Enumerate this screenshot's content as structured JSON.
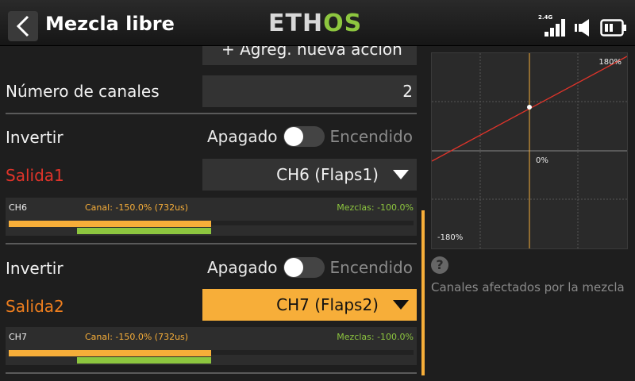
{
  "header": {
    "title": "Mezcla libre",
    "logo_eth": "ETH",
    "logo_os": "OS",
    "signal_label": "2.4G"
  },
  "main": {
    "add_action_label": "+ Agreg. nueva acción",
    "num_channels": {
      "label": "Número de canales",
      "value": "2"
    },
    "outputs": [
      {
        "invert_label": "Invertir",
        "off_label": "Apagado",
        "on_label": "Encendido",
        "output_label": "Salida1",
        "output_label_color": "#e0342a",
        "channel_value": "CH6 (Flaps1)",
        "bar": {
          "channel": "CH6",
          "canal_text": "Canal: -150.0% (732us)",
          "mezclas_text": "Mezclas: -100.0%",
          "canal_percent": -150.0,
          "mezclas_percent": -100.0
        }
      },
      {
        "invert_label": "Invertir",
        "off_label": "Apagado",
        "on_label": "Encendido",
        "output_label": "Salida2",
        "output_label_color": "#f07f1e",
        "channel_value": "CH7 (Flaps2)",
        "bar": {
          "channel": "CH7",
          "canal_text": "Canal: -150.0% (732us)",
          "mezclas_text": "Mezclas: -100.0%",
          "canal_percent": -150.0,
          "mezclas_percent": -100.0
        }
      }
    ]
  },
  "graph": {
    "top_right_label": "180%",
    "bottom_left_label": "-180%",
    "center_label": "0%"
  },
  "help": {
    "icon": "question-icon",
    "text": "Canales afectados por la mezcla"
  },
  "colors": {
    "accent": "#f7ae39",
    "green": "#8dc63f",
    "curve": "#e0342a"
  }
}
